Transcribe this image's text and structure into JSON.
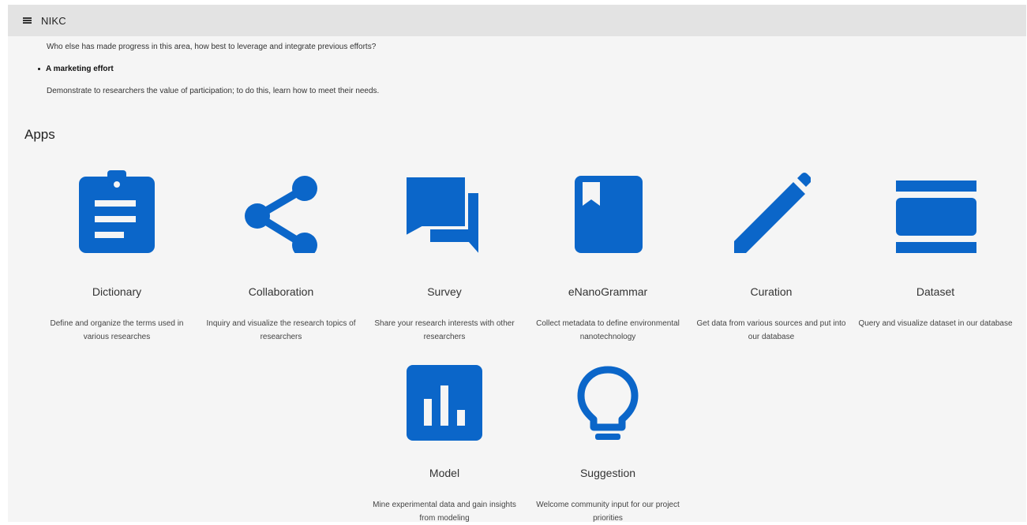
{
  "header": {
    "title": "NIKC",
    "menu_icon": "hamburger-menu-icon"
  },
  "intro": {
    "line1": "Who else has made progress in this area, how best to leverage and integrate previous efforts?",
    "bullet": "A marketing effort",
    "line2": "Demonstrate to researchers the value of participation; to do this, learn how to meet their needs."
  },
  "apps_section": {
    "title": "Apps"
  },
  "apps": [
    {
      "name": "Dictionary",
      "icon": "clipboard-icon",
      "desc": "Define and organize the terms used in various researches"
    },
    {
      "name": "Collaboration",
      "icon": "share-icon",
      "desc": "Inquiry and visualize the research topics of researchers"
    },
    {
      "name": "Survey",
      "icon": "chat-bubbles-icon",
      "desc": "Share your research interests with other researchers"
    },
    {
      "name": "eNanoGrammar",
      "icon": "book-icon",
      "desc": "Collect metadata to define environmental nanotechnology"
    },
    {
      "name": "Curation",
      "icon": "pencil-icon",
      "desc": "Get data from various sources and put into our database"
    },
    {
      "name": "Dataset",
      "icon": "dataset-icon",
      "desc": "Query and visualize dataset in our database"
    },
    {
      "name": "Model",
      "icon": "bar-chart-icon",
      "desc": "Mine experimental data and gain insights from modeling"
    },
    {
      "name": "Suggestion",
      "icon": "lightbulb-icon",
      "desc": "Welcome community input for our project priorities"
    }
  ],
  "colors": {
    "accent": "#0b66c9",
    "topbar": "#e3e3e3",
    "background": "#f5f5f5"
  }
}
